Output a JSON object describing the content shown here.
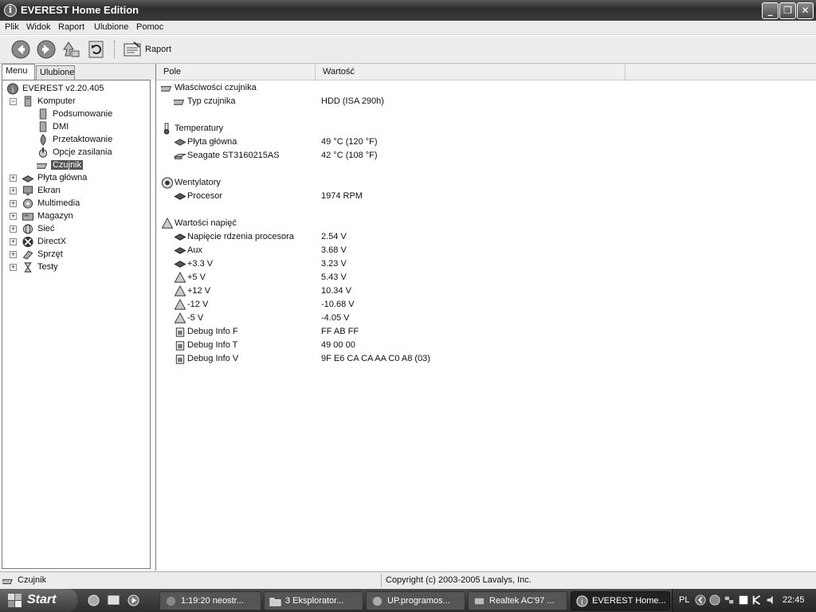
{
  "window": {
    "title": "EVEREST Home Edition",
    "app_icon_glyph": "i",
    "minimize_glyph": "_",
    "maximize_glyph": "❐",
    "close_glyph": "✕"
  },
  "menu": [
    "Plik",
    "Widok",
    "Raport",
    "Ulubione",
    "Pomoc"
  ],
  "toolbar": {
    "raport_label": "Raport",
    "icons": [
      "back-arrow-icon",
      "forward-arrow-icon",
      "up-arrow-icon",
      "refresh-icon",
      "report-icon"
    ]
  },
  "tabs": [
    "Menu",
    "Ulubione"
  ],
  "tree": {
    "root": "EVEREST v2.20.405",
    "computer": "Komputer",
    "children": [
      "Podsumowanie",
      "DMI",
      "Przetaktowanie",
      "Opcje zasilania",
      "Czujnik"
    ],
    "selected": "Czujnik",
    "items": [
      "Płyta główna",
      "Ekran",
      "Multimedia",
      "Magazyn",
      "Sieć",
      "DirectX",
      "Sprzęt",
      "Testy"
    ],
    "expand_plus": "+",
    "expand_minus": "−"
  },
  "columns": {
    "field": "Pole",
    "value": "Wartość"
  },
  "sections": {
    "sensor": {
      "title": "Właściwości czujnika",
      "rows": [
        {
          "field": "Typ czujnika",
          "value": "HDD  (ISA 290h)"
        }
      ]
    },
    "temperatures": {
      "title": "Temperatury",
      "rows": [
        {
          "field": "Płyta główna",
          "value": "49 °C  (120 °F)"
        },
        {
          "field": "Seagate ST3160215AS",
          "value": "42 °C  (108 °F)"
        }
      ]
    },
    "fans": {
      "title": "Wentylatory",
      "rows": [
        {
          "field": "Procesor",
          "value": "1974 RPM"
        }
      ]
    },
    "voltages": {
      "title": "Wartości napięć",
      "rows": [
        {
          "field": "Napięcie rdzenia procesora",
          "value": "2.54 V"
        },
        {
          "field": "Aux",
          "value": "3.68 V"
        },
        {
          "field": "+3.3 V",
          "value": "3.23 V"
        },
        {
          "field": "+5 V",
          "value": "5.43 V"
        },
        {
          "field": "+12 V",
          "value": "10.34 V"
        },
        {
          "field": "-12 V",
          "value": "-10.68 V"
        },
        {
          "field": "-5 V",
          "value": "-4.05 V"
        },
        {
          "field": "Debug Info F",
          "value": "FF AB FF"
        },
        {
          "field": "Debug Info T",
          "value": "49 00 00"
        },
        {
          "field": "Debug Info V",
          "value": "9F E6 CA CA AA C0 A8 (03)"
        }
      ]
    }
  },
  "status": {
    "left": "Czujnik",
    "right": "Copyright (c) 2003-2005 Lavalys, Inc."
  },
  "taskbar": {
    "start": "Start",
    "tasks": [
      "1:19:20 neostr...",
      "3 Eksplorator...",
      "UP.programos...",
      "Realtek AC'97 ...",
      "EVEREST Home..."
    ],
    "lang": "PL",
    "clock": "22:45"
  },
  "colors": {
    "titlebar": "#3a3a3a",
    "selection": "#555555",
    "panel": "#ececec"
  }
}
